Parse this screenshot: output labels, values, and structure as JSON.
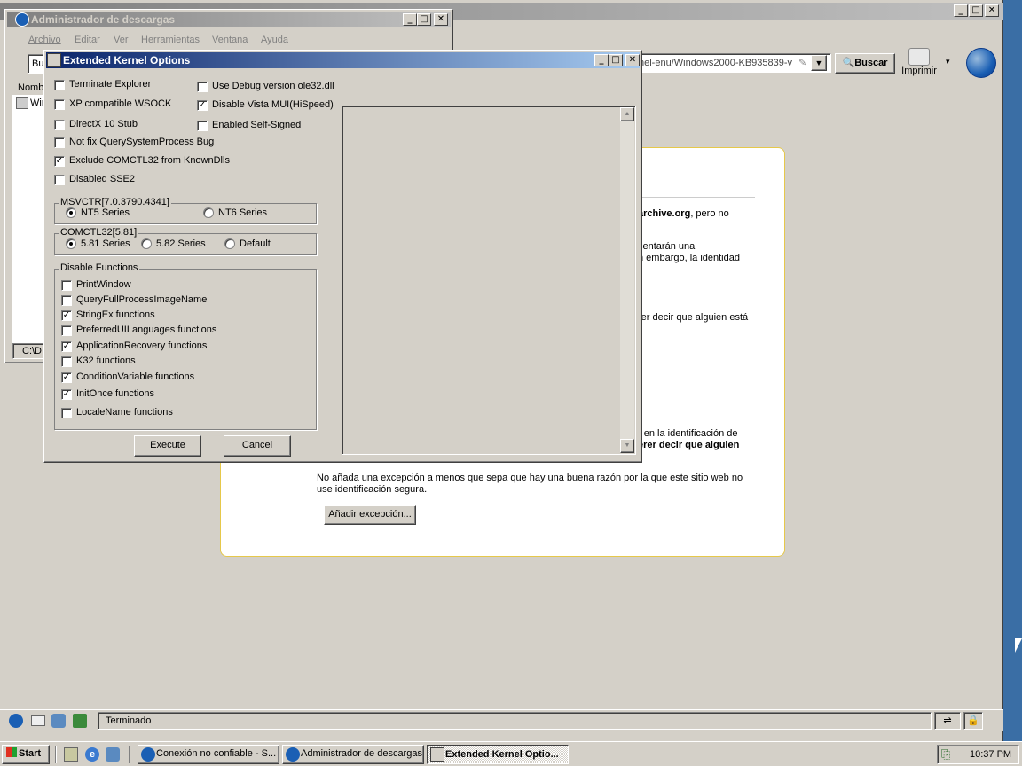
{
  "browser": {
    "search_button": "Buscar",
    "print_label": "Imprimir",
    "url_fragment": "nel-enu/Windows2000-KB935839-v",
    "status_text": "Terminado"
  },
  "page": {
    "text1_bold": "archive.org",
    "text1_rest": ", pero no",
    "text2": "sentarán una",
    "text3": "n embargo, la identidad",
    "text4": "rer decir que alguien está",
    "text5": "r en la identificación de",
    "text6": "erer decir que alguien",
    "warning": "No añada una excepción a menos que sepa que hay una buena razón por la que este sitio web no use identificación segura.",
    "add_exception_button": "Añadir excepción..."
  },
  "download_manager": {
    "title": "Administrador de descargas",
    "menu": [
      "Archivo",
      "Editar",
      "Ver",
      "Herramientas",
      "Ventana",
      "Ayuda"
    ],
    "search_prefix": "Bu",
    "col_name": "Nombr",
    "row_prefix": "Win",
    "status_prefix": "C:\\D"
  },
  "dialog": {
    "title": "Extended Kernel Options",
    "checks_left": [
      {
        "label": "Terminate Explorer",
        "checked": false
      },
      {
        "label": "XP compatible WSOCK",
        "checked": false
      },
      {
        "label": "DirectX 10 Stub",
        "checked": false
      },
      {
        "label": "Not fix QuerySystemProcess Bug",
        "checked": false
      },
      {
        "label": "Exclude COMCTL32 from KnownDlls",
        "checked": true
      },
      {
        "label": "Disabled SSE2",
        "checked": false
      }
    ],
    "checks_right": [
      {
        "label": "Use Debug version ole32.dll",
        "checked": false
      },
      {
        "label": "Disable Vista MUI(HiSpeed)",
        "checked": true
      },
      {
        "label": "Enabled Self-Signed",
        "checked": false
      }
    ],
    "msvctr": {
      "label": "MSVCTR[7.0.3790.4341]",
      "options": [
        {
          "label": "NT5 Series",
          "selected": true
        },
        {
          "label": "NT6 Series",
          "selected": false
        }
      ]
    },
    "comctl": {
      "label": "COMCTL32[5.81]",
      "options": [
        {
          "label": "5.81 Series",
          "selected": true
        },
        {
          "label": "5.82 Series",
          "selected": false
        },
        {
          "label": "Default",
          "selected": false
        }
      ]
    },
    "disable_functions": {
      "label": "Disable Functions",
      "items": [
        {
          "label": "PrintWindow",
          "checked": false
        },
        {
          "label": "QueryFullProcessImageName",
          "checked": false
        },
        {
          "label": "StringEx functions",
          "checked": true
        },
        {
          "label": "PreferredUILanguages functions",
          "checked": false
        },
        {
          "label": "ApplicationRecovery functions",
          "checked": true
        },
        {
          "label": "K32 functions",
          "checked": false
        },
        {
          "label": "ConditionVariable functions",
          "checked": true
        },
        {
          "label": "InitOnce functions",
          "checked": true
        },
        {
          "label": "LocaleName functions",
          "checked": false
        }
      ]
    },
    "execute_button": "Execute",
    "cancel_button": "Cancel"
  },
  "taskbar": {
    "start": "Start",
    "tasks": [
      {
        "label": "Conexión no confiable - S...",
        "active": false
      },
      {
        "label": "Administrador de descargas",
        "active": false
      },
      {
        "label": "Extended Kernel Optio...",
        "active": true
      }
    ],
    "clock": "10:37 PM"
  }
}
